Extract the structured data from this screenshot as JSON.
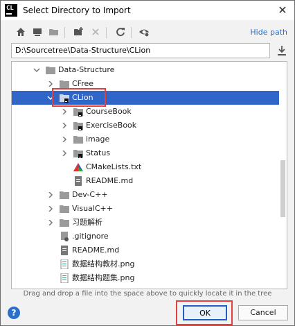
{
  "window": {
    "title": "Select Directory to Import",
    "app_logo": "CL"
  },
  "toolbar": {
    "buttons": [
      "home-icon",
      "desktop-icon",
      "project-folder-icon",
      "new-folder-icon",
      "delete-icon",
      "refresh-icon",
      "show-hidden-icon"
    ],
    "hide_path_label": "Hide path"
  },
  "path": {
    "value": "D:\\Sourcetree\\Data-Structure\\CLion"
  },
  "tree": {
    "items": [
      {
        "label": "Data-Structure",
        "icon": "folder-icon"
      },
      {
        "label": "CFree",
        "icon": "folder-icon"
      },
      {
        "label": "CLion",
        "icon": "project-folder-icon",
        "selected": true
      },
      {
        "label": "CourseBook",
        "icon": "project-folder-icon"
      },
      {
        "label": "ExerciseBook",
        "icon": "project-folder-icon"
      },
      {
        "label": "image",
        "icon": "folder-icon"
      },
      {
        "label": "Status",
        "icon": "project-folder-icon"
      },
      {
        "label": "CMakeLists.txt",
        "icon": "cmake-icon"
      },
      {
        "label": "README.md",
        "icon": "markdown-file-icon"
      },
      {
        "label": "Dev-C++",
        "icon": "folder-icon"
      },
      {
        "label": "VisualC++",
        "icon": "folder-icon"
      },
      {
        "label": "习题解析",
        "icon": "folder-icon"
      },
      {
        "label": ".gitignore",
        "icon": "gitignore-file-icon"
      },
      {
        "label": "README.md",
        "icon": "markdown-file-icon"
      },
      {
        "label": "数据结构教材.png",
        "icon": "image-file-icon"
      },
      {
        "label": "数据结构题集.png",
        "icon": "image-file-icon"
      }
    ]
  },
  "hint": "Drag and drop a file into the space above to quickly locate it in the tree",
  "buttons": {
    "ok": "OK",
    "cancel": "Cancel",
    "help": "?"
  },
  "colors": {
    "selection": "#2f66c7",
    "highlight_box": "#e24040",
    "link": "#2a6fc9"
  }
}
